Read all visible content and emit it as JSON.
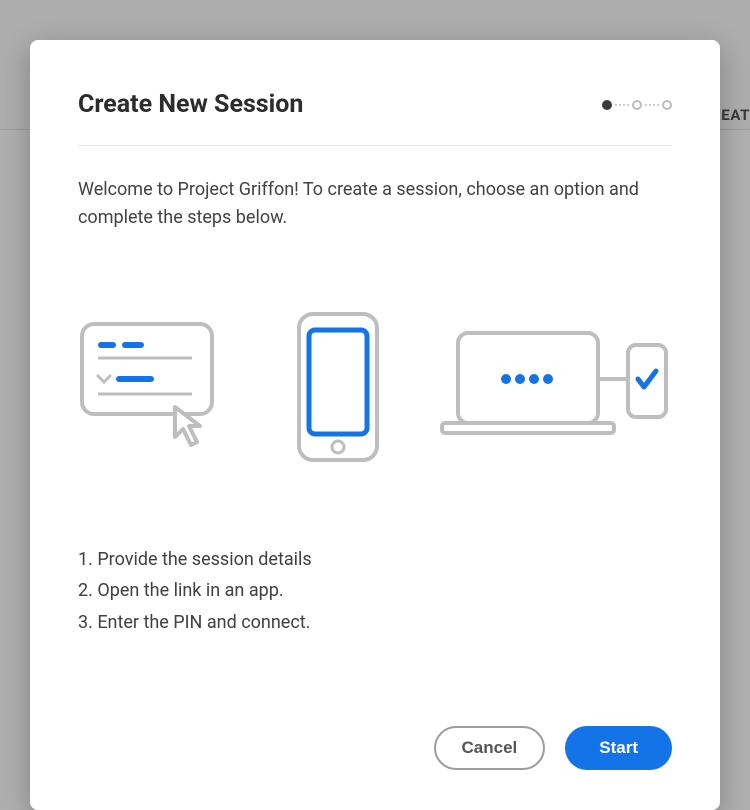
{
  "background": {
    "truncated_button": "EAT"
  },
  "dialog": {
    "title": "Create New Session",
    "welcome": "Welcome to Project Griffon! To create a session, choose an option and complete the steps below.",
    "steps": [
      "1. Provide the session details",
      "2. Open the link in an app.",
      "3. Enter the PIN and connect."
    ],
    "buttons": {
      "cancel": "Cancel",
      "start": "Start"
    }
  }
}
